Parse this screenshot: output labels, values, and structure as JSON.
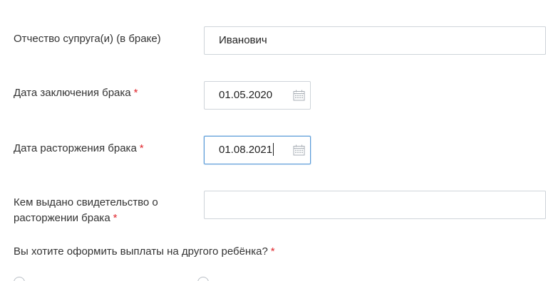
{
  "form": {
    "spouse_patronymic": {
      "label": "Отчество супруга(и) (в браке)",
      "value": "Иванович"
    },
    "marriage_date": {
      "label": "Дата заключения брака",
      "required_mark": "*",
      "value": "01.05.2020",
      "icon": "calendar-icon"
    },
    "divorce_date": {
      "label": "Дата расторжения брака",
      "required_mark": "*",
      "value": "01.08.2021",
      "icon": "calendar-icon"
    },
    "divorce_certificate_issuer": {
      "label_line1": "Кем выдано свидетельство о",
      "label_line2": "расторжении брака",
      "required_mark": "*",
      "value": ""
    },
    "other_child_question": {
      "label": "Вы хотите оформить выплаты на другого ребёнка?",
      "required_mark": "*"
    }
  },
  "colors": {
    "required": "#e0272d",
    "focus_border": "#5a9bd8",
    "border": "#cfd4da"
  }
}
